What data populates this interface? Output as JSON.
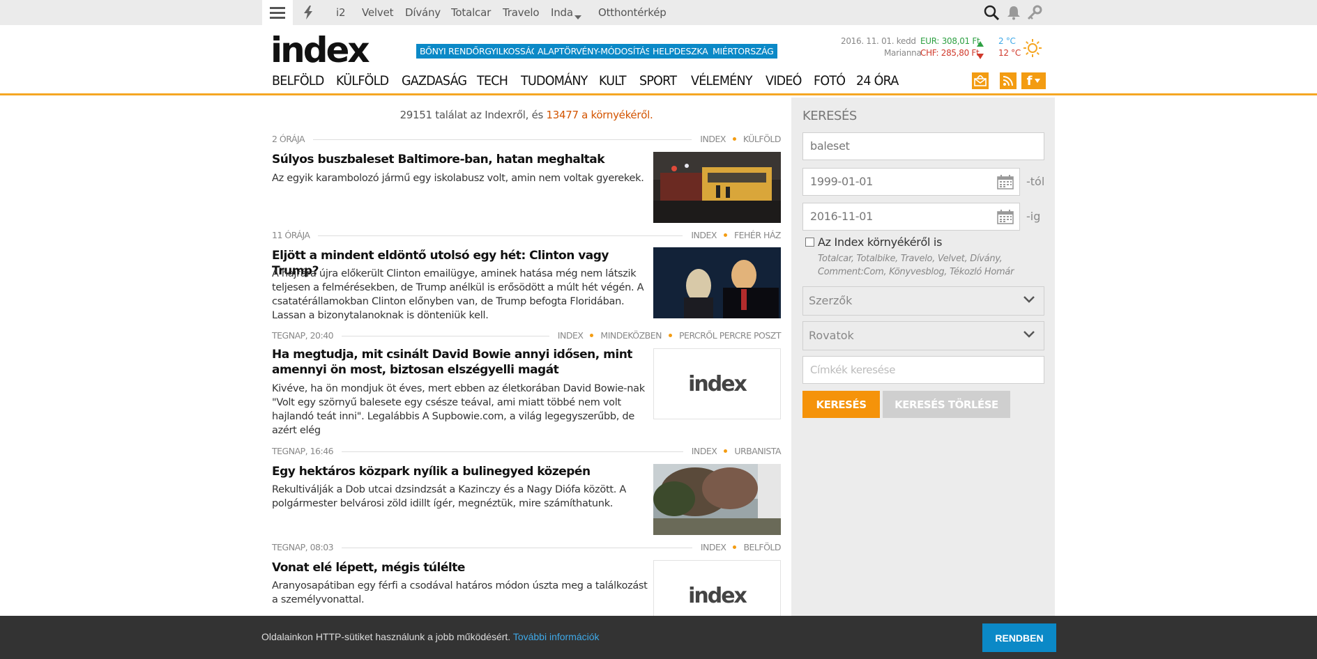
{
  "topbar": {
    "links": [
      "i2",
      "Velvet",
      "Dívány",
      "Totalcar",
      "Travelo",
      "Inda",
      "Otthontérkép"
    ]
  },
  "header": {
    "logo": "index",
    "hot_tags": [
      "BŐNYI RENDŐRGYILKOSSÁG",
      "ALAPTÖRVÉNY-MÓDOSÍTÁS",
      "HELPDESZKA",
      "MIÉRTORSZÁG"
    ],
    "date": "2016. 11. 01. kedd",
    "nameday": "Marianna",
    "eur": "EUR: 308,01 Ft",
    "chf": "CHF: 285,80 Ft",
    "temp_low": "2 °C",
    "temp_high": "12 °C"
  },
  "nav": [
    "BELFÖLD",
    "KÜLFÖLD",
    "GAZDASÁG",
    "TECH",
    "TUDOMÁNY",
    "KULT",
    "SPORT",
    "VÉLEMÉNY",
    "VIDEÓ",
    "FOTÓ",
    "24 ÓRA"
  ],
  "results": {
    "prefix": "29151 találat az Indexről, és ",
    "link": "13477 a környékéről."
  },
  "articles": [
    {
      "date": "2 ÓRÁJA",
      "cats": [
        "INDEX",
        "KÜLFÖLD"
      ],
      "title": "Súlyos buszbaleset Baltimore-ban, hatan meghaltak",
      "lead": "Az egyik karambolozó jármű egy iskolabusz volt, amin nem voltak gyerekek."
    },
    {
      "date": "11 ÓRÁJA",
      "cats": [
        "INDEX",
        "FEHÉR HÁZ"
      ],
      "title": "Eljött a mindent eldöntő utolsó egy hét: Clinton vagy Trump?",
      "lead": "A hajrára újra előkerült Clinton emailügye, aminek hatása még nem látszik teljesen a felmérésekben, de Trump anélkül is erősödött a múlt hét végén. A csatatérállamokban Clinton előnyben van, de Trump befogta Floridában. Lassan a bizonytalanoknak is dönteniük kell."
    },
    {
      "date": "TEGNAP, 20:40",
      "cats": [
        "INDEX",
        "MINDEKÖZBEN",
        "PERCRŐL PERCRE POSZT"
      ],
      "title": "Ha megtudja, mit csinált David Bowie annyi idősen, mint amennyi ön most, biztosan elszégyelli magát",
      "lead": "Kivéve, ha ön mondjuk öt éves, mert ebben az életkorában David Bowie-nak \"Volt egy szörnyű balesete egy csésze teával, ami miatt többé nem volt hajlandó teát inni\". Legalábbis A Supbowie.com, a világ legegyszerűbb, de azért elég",
      "thumb": "index"
    },
    {
      "date": "TEGNAP, 16:46",
      "cats": [
        "INDEX",
        "URBANISTA"
      ],
      "title": "Egy hektáros közpark nyílik a bulinegyed közepén",
      "lead": "Rekultiválják a Dob utcai dzsindzsát a Kazinczy és a Nagy Diófa között. A polgármester belvárosi zöld idillt ígér, megnéztük, mire számíthatunk."
    },
    {
      "date": "TEGNAP, 08:03",
      "cats": [
        "INDEX",
        "BELFÖLD"
      ],
      "title": "Vonat elé lépett, mégis túlélte",
      "lead": "Aranyosapátiban egy férfi a csodával határos módon úszta meg a találkozást a személyvonattal.",
      "thumb": "index"
    }
  ],
  "sidebar": {
    "heading": "KERESÉS",
    "query": "baleset",
    "date_from": "1999-01-01",
    "date_from_suffix": "-tól",
    "date_to": "2016-11-01",
    "date_to_suffix": "-ig",
    "checkbox_label": "Az Index környékéről is",
    "checkbox_sites": "Totalcar, Totalbike, Travelo, Velvet, Dívány, Comment:Com, Könyvesblog, Tékozló Homár",
    "authors": "Szerzők",
    "sections": "Rovatok",
    "tags_placeholder": "Címkék keresése",
    "search_button": "KERESÉS",
    "clear_button": "KERESÉS TÖRLÉSE"
  },
  "cookie": {
    "text": "Oldalainkon HTTP-sütiket használunk a jobb működésért.",
    "link": "További információk",
    "button": "RENDBEN"
  },
  "colors": {
    "accent": "#f39c12",
    "tag_blue": "#0b89c7",
    "eur_green": "#2ea043",
    "chf_red": "#d0392b"
  }
}
